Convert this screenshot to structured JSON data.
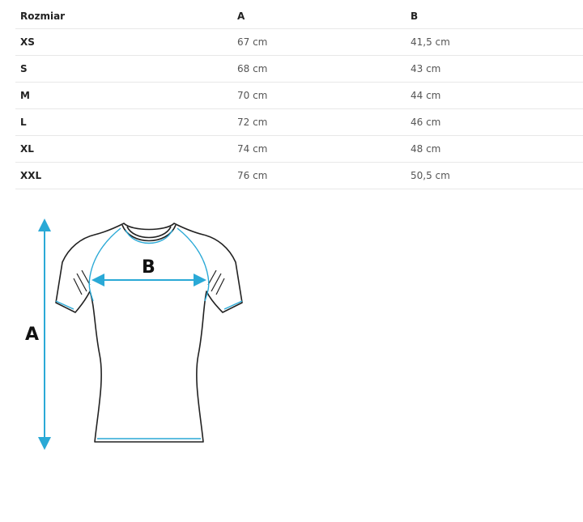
{
  "table": {
    "headers": [
      "Rozmiar",
      "A",
      "B"
    ],
    "rows": [
      {
        "size": "XS",
        "a": "67 cm",
        "b": "41,5 cm"
      },
      {
        "size": "S",
        "a": "68 cm",
        "b": "43 cm"
      },
      {
        "size": "M",
        "a": "70 cm",
        "b": "44 cm"
      },
      {
        "size": "L",
        "a": "72 cm",
        "b": "46 cm"
      },
      {
        "size": "XL",
        "a": "74 cm",
        "b": "48 cm"
      },
      {
        "size": "XXL",
        "a": "76 cm",
        "b": "50,5 cm"
      }
    ]
  },
  "diagram": {
    "label_a": "A",
    "label_b": "B",
    "accent_color": "#2aa9d6",
    "outline_color": "#222222",
    "icon": "tshirt-measurement-icon"
  }
}
